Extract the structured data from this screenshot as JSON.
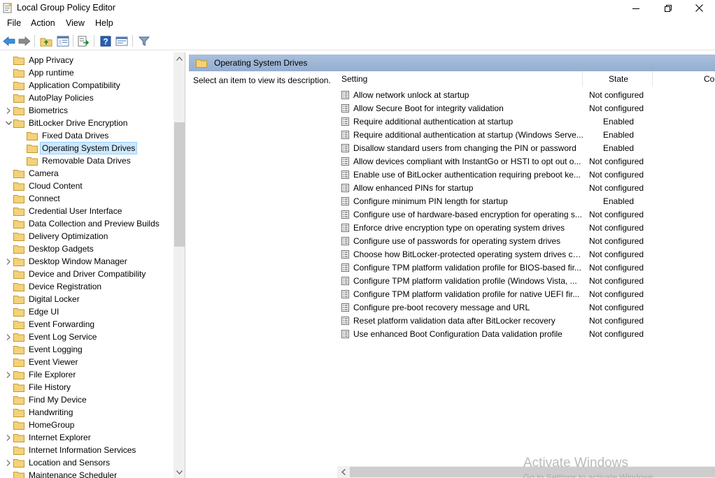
{
  "window": {
    "title": "Local Group Policy Editor"
  },
  "menu": [
    "File",
    "Action",
    "View",
    "Help"
  ],
  "tree": {
    "items": [
      {
        "label": "App Privacy",
        "level": 0,
        "expandable": false
      },
      {
        "label": "App runtime",
        "level": 0,
        "expandable": false
      },
      {
        "label": "Application Compatibility",
        "level": 0,
        "expandable": false
      },
      {
        "label": "AutoPlay Policies",
        "level": 0,
        "expandable": false
      },
      {
        "label": "Biometrics",
        "level": 0,
        "expandable": true
      },
      {
        "label": "BitLocker Drive Encryption",
        "level": 0,
        "expandable": true,
        "expanded": true
      },
      {
        "label": "Fixed Data Drives",
        "level": 1,
        "expandable": false
      },
      {
        "label": "Operating System Drives",
        "level": 1,
        "expandable": false,
        "selected": true
      },
      {
        "label": "Removable Data Drives",
        "level": 1,
        "expandable": false
      },
      {
        "label": "Camera",
        "level": 0,
        "expandable": false
      },
      {
        "label": "Cloud Content",
        "level": 0,
        "expandable": false
      },
      {
        "label": "Connect",
        "level": 0,
        "expandable": false
      },
      {
        "label": "Credential User Interface",
        "level": 0,
        "expandable": false
      },
      {
        "label": "Data Collection and Preview Builds",
        "level": 0,
        "expandable": false
      },
      {
        "label": "Delivery Optimization",
        "level": 0,
        "expandable": false
      },
      {
        "label": "Desktop Gadgets",
        "level": 0,
        "expandable": false
      },
      {
        "label": "Desktop Window Manager",
        "level": 0,
        "expandable": true
      },
      {
        "label": "Device and Driver Compatibility",
        "level": 0,
        "expandable": false
      },
      {
        "label": "Device Registration",
        "level": 0,
        "expandable": false
      },
      {
        "label": "Digital Locker",
        "level": 0,
        "expandable": false
      },
      {
        "label": "Edge UI",
        "level": 0,
        "expandable": false
      },
      {
        "label": "Event Forwarding",
        "level": 0,
        "expandable": false
      },
      {
        "label": "Event Log Service",
        "level": 0,
        "expandable": true
      },
      {
        "label": "Event Logging",
        "level": 0,
        "expandable": false
      },
      {
        "label": "Event Viewer",
        "level": 0,
        "expandable": false
      },
      {
        "label": "File Explorer",
        "level": 0,
        "expandable": true
      },
      {
        "label": "File History",
        "level": 0,
        "expandable": false
      },
      {
        "label": "Find My Device",
        "level": 0,
        "expandable": false
      },
      {
        "label": "Handwriting",
        "level": 0,
        "expandable": false
      },
      {
        "label": "HomeGroup",
        "level": 0,
        "expandable": false
      },
      {
        "label": "Internet Explorer",
        "level": 0,
        "expandable": true
      },
      {
        "label": "Internet Information Services",
        "level": 0,
        "expandable": false
      },
      {
        "label": "Location and Sensors",
        "level": 0,
        "expandable": true
      },
      {
        "label": "Maintenance Scheduler",
        "level": 0,
        "expandable": false
      }
    ]
  },
  "details": {
    "header_title": "Operating System Drives",
    "description": "Select an item to view its description.",
    "columns": {
      "setting": "Setting",
      "state": "State",
      "comment": "Co"
    },
    "rows": [
      {
        "setting": "Allow network unlock at startup",
        "state": "Not configured"
      },
      {
        "setting": "Allow Secure Boot for integrity validation",
        "state": "Not configured"
      },
      {
        "setting": "Require additional authentication at startup",
        "state": "Enabled"
      },
      {
        "setting": "Require additional authentication at startup (Windows Serve...",
        "state": "Enabled"
      },
      {
        "setting": "Disallow standard users from changing the PIN or password",
        "state": "Enabled"
      },
      {
        "setting": "Allow devices compliant with InstantGo or HSTI to opt out o...",
        "state": "Not configured"
      },
      {
        "setting": "Enable use of BitLocker authentication requiring preboot ke...",
        "state": "Not configured"
      },
      {
        "setting": "Allow enhanced PINs for startup",
        "state": "Not configured"
      },
      {
        "setting": "Configure minimum PIN length for startup",
        "state": "Enabled"
      },
      {
        "setting": "Configure use of hardware-based encryption for operating s...",
        "state": "Not configured"
      },
      {
        "setting": "Enforce drive encryption type on operating system drives",
        "state": "Not configured"
      },
      {
        "setting": "Configure use of passwords for operating system drives",
        "state": "Not configured"
      },
      {
        "setting": "Choose how BitLocker-protected operating system drives ca...",
        "state": "Not configured"
      },
      {
        "setting": "Configure TPM platform validation profile for BIOS-based fir...",
        "state": "Not configured"
      },
      {
        "setting": "Configure TPM platform validation profile (Windows Vista, ...",
        "state": "Not configured"
      },
      {
        "setting": "Configure TPM platform validation profile for native UEFI fir...",
        "state": "Not configured"
      },
      {
        "setting": "Configure pre-boot recovery message and URL",
        "state": "Not configured"
      },
      {
        "setting": "Reset platform validation data after BitLocker recovery",
        "state": "Not configured"
      },
      {
        "setting": "Use enhanced Boot Configuration Data validation profile",
        "state": "Not configured"
      }
    ]
  },
  "watermark": {
    "line1": "Activate Windows",
    "line2": "Go to Settings to activate Windows."
  },
  "colors": {
    "header_bar": "#a9c0dc",
    "selection": "#cce8ff",
    "folder": "#f3d27a"
  }
}
